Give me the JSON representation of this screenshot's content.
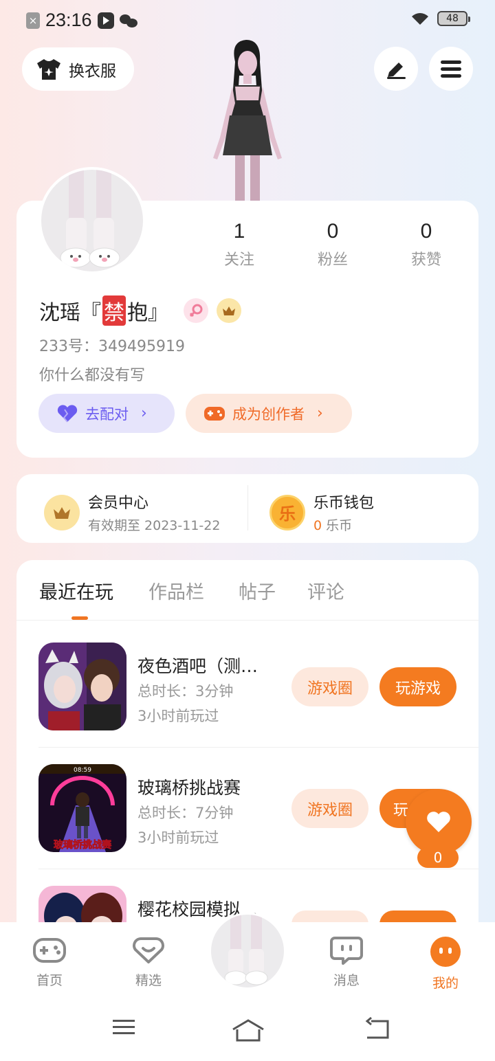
{
  "status_bar": {
    "time": "23:16",
    "battery": "48"
  },
  "header": {
    "outfit_label": "换衣服"
  },
  "profile": {
    "stats": [
      {
        "value": "1",
        "label": "关注"
      },
      {
        "value": "0",
        "label": "粉丝"
      },
      {
        "value": "0",
        "label": "获赞"
      }
    ],
    "name_prefix": "沈瑶『",
    "name_ban": "禁",
    "name_suffix": "抱』",
    "uid": "233号：349495919",
    "bio": "你什么都没有写",
    "pair_label": "去配对",
    "creator_label": "成为创作者"
  },
  "member": {
    "title": "会员中心",
    "sub": "有效期至 2023-11-22"
  },
  "wallet": {
    "title": "乐币钱包",
    "amount": "0",
    "unit": "乐币",
    "coin_char": "乐"
  },
  "tabs": [
    "最近在玩",
    "作品栏",
    "帖子",
    "评论"
  ],
  "games": [
    {
      "title": "夜色酒吧（测…",
      "duration": "总时长：3分钟",
      "last": "3小时前玩过",
      "circle_label": "游戏圈",
      "play_label": "玩游戏"
    },
    {
      "title": "玻璃桥挑战赛",
      "duration": "总时长：7分钟",
      "last": "3小时前玩过",
      "circle_label": "游戏圈",
      "play_label": "玩",
      "thumb_text": "玻璃桥挑战赛",
      "thumb_time": "08:59"
    },
    {
      "title": "樱花校园模拟…"
    }
  ],
  "float": {
    "count": "0"
  },
  "nav": [
    "首页",
    "精选",
    "消息",
    "我的"
  ]
}
